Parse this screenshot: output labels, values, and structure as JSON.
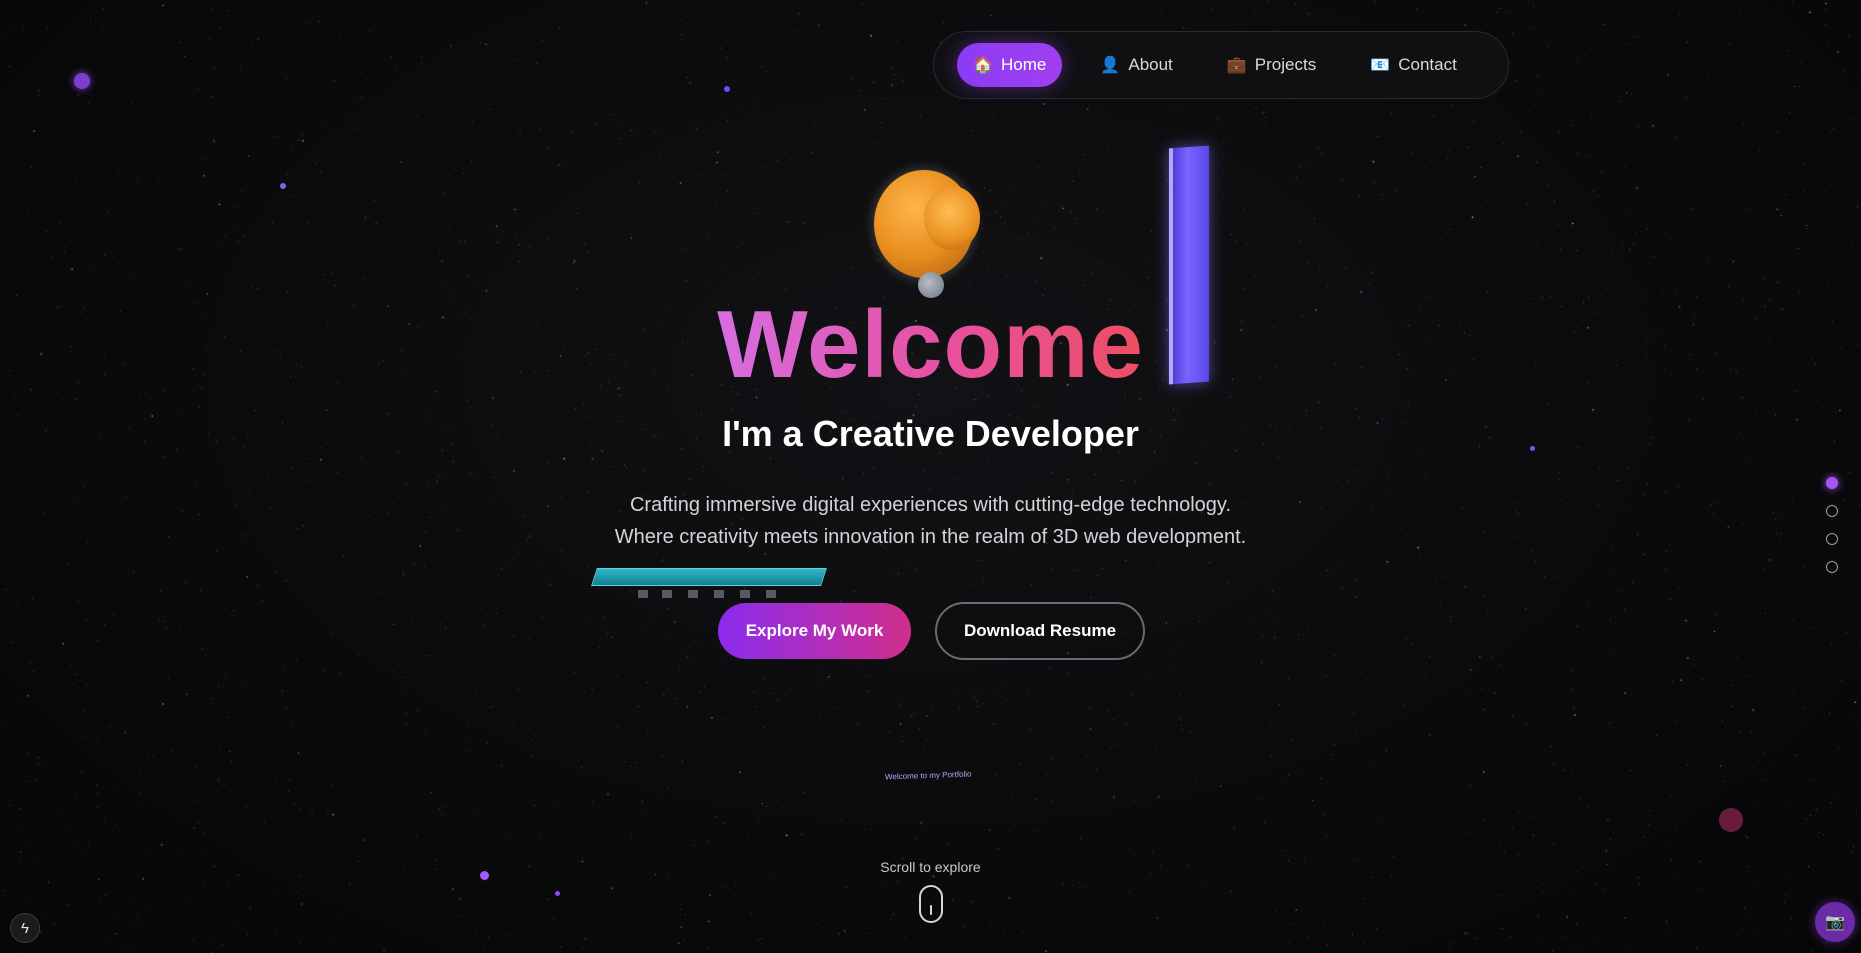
{
  "nav": {
    "items": [
      {
        "label": "Home",
        "icon": "house-icon",
        "glyph": "🏠",
        "active": true
      },
      {
        "label": "About",
        "icon": "person-icon",
        "glyph": "👤",
        "active": false
      },
      {
        "label": "Projects",
        "icon": "briefcase-icon",
        "glyph": "💼",
        "active": false
      },
      {
        "label": "Contact",
        "icon": "mail-icon",
        "glyph": "📧",
        "active": false
      }
    ]
  },
  "hero": {
    "title": "Welcome",
    "subtitle": "I'm a Creative Developer",
    "description_line1": "Crafting immersive digital experiences with cutting-edge technology.",
    "description_line2": "Where creativity meets innovation in the realm of 3D web development.",
    "primary_button": "Explore My Work",
    "secondary_button": "Download Resume",
    "floating_label": "Welcome to my Portfolio"
  },
  "scroll": {
    "text": "Scroll to explore"
  },
  "section_dots": {
    "count": 4,
    "active_index": 0
  },
  "corner": {
    "left_icon": "lightning-icon",
    "left_glyph": "ϟ",
    "right_icon": "camera-icon",
    "right_glyph": "📷"
  },
  "colors": {
    "accent": "#a855f7",
    "title_gradient_start": "#d66ee0",
    "title_gradient_end": "#ee4f62",
    "background": "#0a0a0b"
  }
}
